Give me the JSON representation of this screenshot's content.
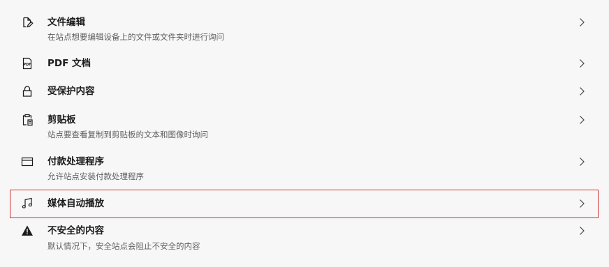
{
  "items": [
    {
      "icon": "file-edit-icon",
      "title": "文件编辑",
      "description": "在站点想要编辑设备上的文件或文件夹时进行询问"
    },
    {
      "icon": "pdf-icon",
      "title": "PDF 文档",
      "description": ""
    },
    {
      "icon": "lock-icon",
      "title": "受保护内容",
      "description": ""
    },
    {
      "icon": "clipboard-icon",
      "title": "剪贴板",
      "description": "站点要查看复制到剪贴板的文本和图像时询问"
    },
    {
      "icon": "credit-card-icon",
      "title": "付款处理程序",
      "description": "允许站点安装付款处理程序"
    },
    {
      "icon": "music-note-icon",
      "title": "媒体自动播放",
      "description": "",
      "highlighted": true
    },
    {
      "icon": "warning-icon",
      "title": "不安全的内容",
      "description": "默认情况下，安全站点会阻止不安全的内容"
    }
  ],
  "colors": {
    "background": "#f7f7f7",
    "highlight_border": "#d32f2f",
    "description_text": "#5e5e5e"
  }
}
